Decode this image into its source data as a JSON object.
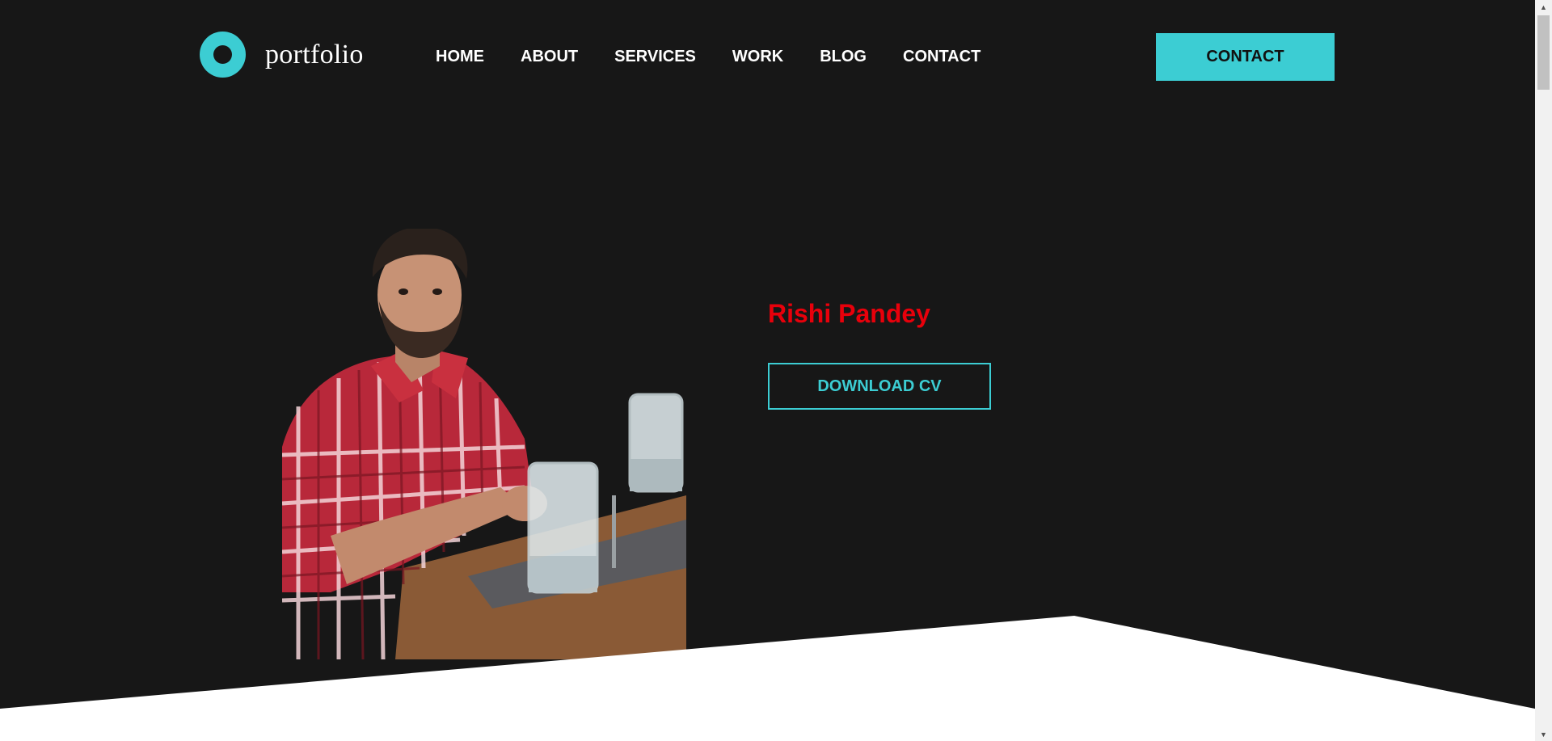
{
  "brand": {
    "name": "portfolio",
    "accent": "#3ccdd3"
  },
  "nav": {
    "items": [
      "HOME",
      "ABOUT",
      "SERVICES",
      "WORK",
      "BLOG",
      "CONTACT"
    ]
  },
  "header": {
    "contact_label": "CONTACT"
  },
  "hero": {
    "name": "Rishi Pandey",
    "name_color": "#e8000b",
    "cv_label": "DOWNLOAD CV",
    "photo_icon": "profile-photo"
  },
  "colors": {
    "background": "#171717",
    "text": "#ffffff",
    "bottom_band": "#ffffff"
  }
}
